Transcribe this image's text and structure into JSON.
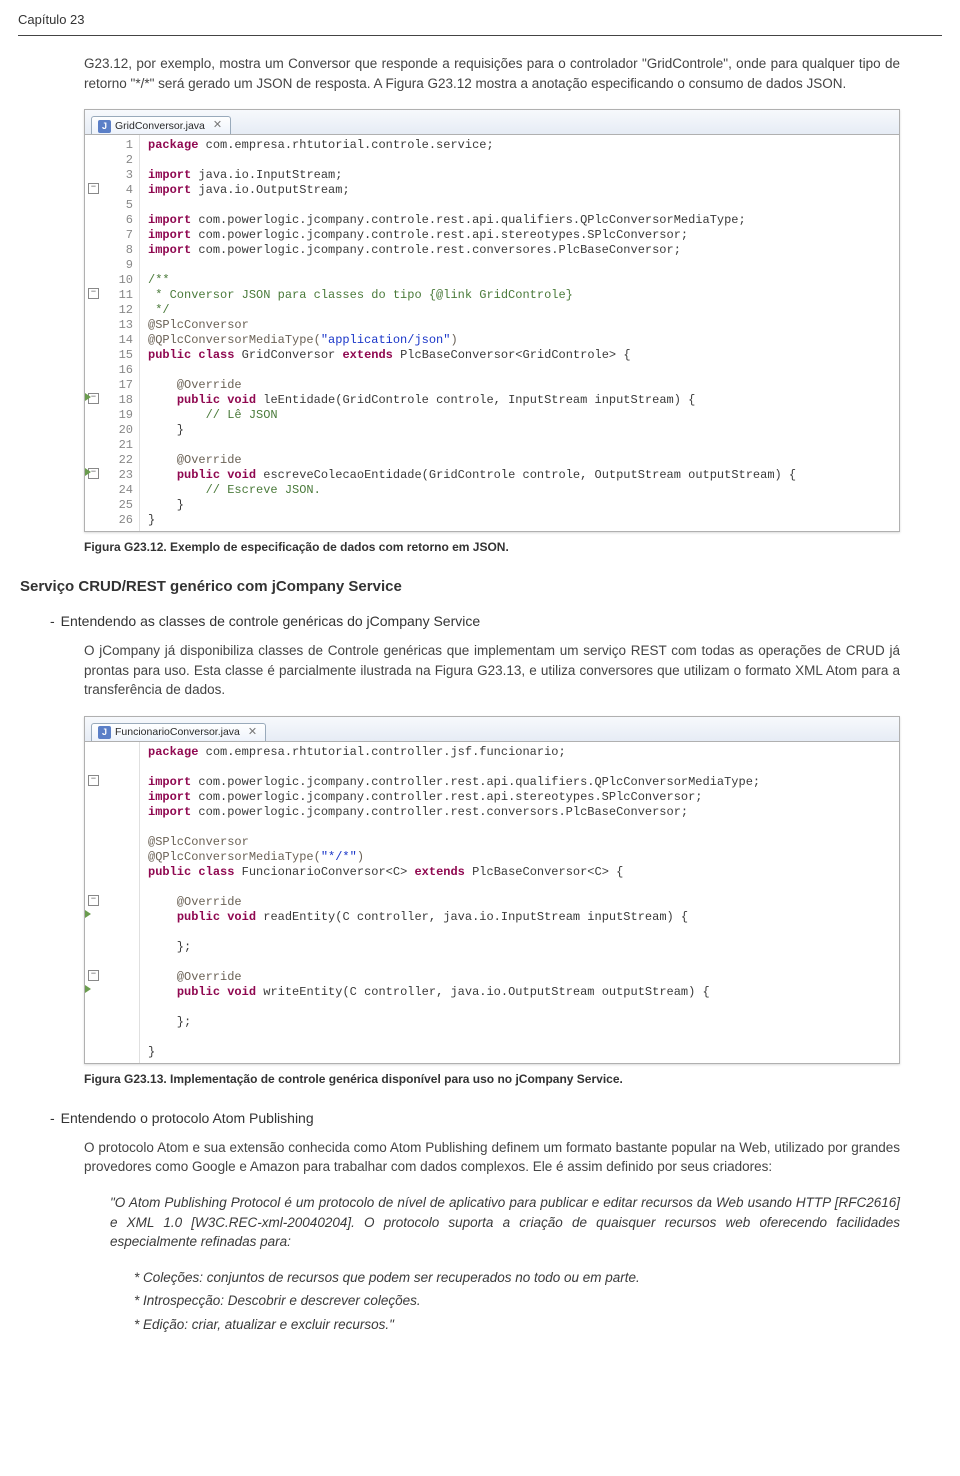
{
  "chapter_label": "Capítulo 23",
  "para1": "G23.12, por exemplo, mostra um Conversor que responde a requisições para o controlador \"GridControle\", onde para qualquer tipo de retorno \"*/*\" será gerado um JSON de resposta. A Figura G23.12 mostra a anotação especificando o consumo de dados JSON.",
  "code1": {
    "tab": "GridConversor.java",
    "lines": [
      {
        "n": "1",
        "t": "package com.empresa.rhtutorial.controle.service;",
        "cls": ""
      },
      {
        "n": "2",
        "t": "",
        "cls": ""
      },
      {
        "n": "3",
        "t": "import java.io.InputStream;",
        "cls": "",
        "fold": true
      },
      {
        "n": "4",
        "t": "import java.io.OutputStream;",
        "cls": ""
      },
      {
        "n": "5",
        "t": "",
        "cls": ""
      },
      {
        "n": "6",
        "t": "import com.powerlogic.jcompany.controle.rest.api.qualifiers.QPlcConversorMediaType;",
        "cls": ""
      },
      {
        "n": "7",
        "t": "import com.powerlogic.jcompany.controle.rest.api.stereotypes.SPlcConversor;",
        "cls": ""
      },
      {
        "n": "8",
        "t": "import com.powerlogic.jcompany.controle.rest.conversores.PlcBaseConversor;",
        "cls": ""
      },
      {
        "n": "9",
        "t": "",
        "cls": ""
      },
      {
        "n": "10",
        "t": "/**",
        "cls": "cmt",
        "fold": true
      },
      {
        "n": "11",
        "t": " * Conversor JSON para classes do tipo {@link GridControle}",
        "cls": "cmt"
      },
      {
        "n": "12",
        "t": " */",
        "cls": "cmt"
      },
      {
        "n": "13",
        "t": "@SPlcConversor",
        "cls": "ann"
      },
      {
        "n": "14",
        "t": "@QPlcConversorMediaType(\"application/json\")",
        "cls": "ann"
      },
      {
        "n": "15",
        "t": "public class GridConversor extends PlcBaseConversor<GridControle> {",
        "cls": ""
      },
      {
        "n": "16",
        "t": "",
        "cls": ""
      },
      {
        "n": "17",
        "t": "    @Override",
        "cls": "ann",
        "fold": true
      },
      {
        "n": "18",
        "t": "    public void leEntidade(GridControle controle, InputStream inputStream) {",
        "cls": "",
        "tri": true
      },
      {
        "n": "19",
        "t": "        // Lê JSON",
        "cls": "cmt"
      },
      {
        "n": "20",
        "t": "    }",
        "cls": ""
      },
      {
        "n": "21",
        "t": "",
        "cls": ""
      },
      {
        "n": "22",
        "t": "    @Override",
        "cls": "ann",
        "fold": true
      },
      {
        "n": "23",
        "t": "    public void escreveColecaoEntidade(GridControle controle, OutputStream outputStream) {",
        "cls": "",
        "tri": true
      },
      {
        "n": "24",
        "t": "        // Escreve JSON.",
        "cls": "cmt"
      },
      {
        "n": "25",
        "t": "    }",
        "cls": ""
      },
      {
        "n": "26",
        "t": "}",
        "cls": ""
      }
    ]
  },
  "caption1": "Figura G23.12. Exemplo de especificação de dados com retorno em JSON.",
  "section_title": "Serviço CRUD/REST genérico com jCompany Service",
  "sub1": "Entendendo as classes de controle genéricas do jCompany Service",
  "para2": "O jCompany já disponibiliza classes de Controle genéricas que implementam um serviço REST com todas as operações de CRUD já prontas para uso. Esta classe é parcialmente ilustrada na Figura G23.13, e utiliza conversores que utilizam o formato XML Atom para a transferência de dados.",
  "code2": {
    "tab": "FuncionarioConversor.java",
    "lines": [
      {
        "t": "package com.empresa.rhtutorial.controller.jsf.funcionario;",
        "cls": ""
      },
      {
        "t": "",
        "cls": ""
      },
      {
        "t": "import com.powerlogic.jcompany.controller.rest.api.qualifiers.QPlcConversorMediaType;",
        "cls": "",
        "fold": true
      },
      {
        "t": "import com.powerlogic.jcompany.controller.rest.api.stereotypes.SPlcConversor;",
        "cls": ""
      },
      {
        "t": "import com.powerlogic.jcompany.controller.rest.conversors.PlcBaseConversor;",
        "cls": ""
      },
      {
        "t": "",
        "cls": ""
      },
      {
        "t": "@SPlcConversor",
        "cls": "ann"
      },
      {
        "t": "@QPlcConversorMediaType(\"*/*\")",
        "cls": "ann"
      },
      {
        "t": "public class FuncionarioConversor<C> extends PlcBaseConversor<C> {",
        "cls": ""
      },
      {
        "t": "",
        "cls": ""
      },
      {
        "t": "    @Override",
        "cls": "ann",
        "fold": true
      },
      {
        "t": "    public void readEntity(C controller, java.io.InputStream inputStream) {",
        "cls": "",
        "tri": true
      },
      {
        "t": "",
        "cls": ""
      },
      {
        "t": "    };",
        "cls": ""
      },
      {
        "t": "",
        "cls": ""
      },
      {
        "t": "    @Override",
        "cls": "ann",
        "fold": true
      },
      {
        "t": "    public void writeEntity(C controller, java.io.OutputStream outputStream) {",
        "cls": "",
        "tri": true
      },
      {
        "t": "",
        "cls": ""
      },
      {
        "t": "    };",
        "cls": ""
      },
      {
        "t": "",
        "cls": ""
      },
      {
        "t": "}",
        "cls": ""
      }
    ]
  },
  "caption2": "Figura G23.13. Implementação de controle genérica disponível para uso no jCompany Service.",
  "sub2": "Entendendo o protocolo Atom Publishing",
  "para3": "O protocolo Atom e sua extensão conhecida como Atom Publishing definem um formato bastante popular na Web, utilizado por grandes provedores como Google e Amazon para trabalhar com dados complexos. Ele é assim definido por seus criadores:",
  "quote": "\"O Atom Publishing Protocol é um protocolo de nível de aplicativo para publicar e editar recursos da Web usando HTTP [RFC2616] e XML 1.0 [W3C.REC-xml-20040204]. O protocolo suporta a criação de quaisquer recursos web oferecendo facilidades especialmente refinadas para:",
  "li1": "* Coleções: conjuntos de recursos que podem ser recuperados no todo ou em parte.",
  "li2": "* Introspecção: Descobrir e descrever coleções.",
  "li3": "* Edição: criar, atualizar e excluir recursos.\""
}
